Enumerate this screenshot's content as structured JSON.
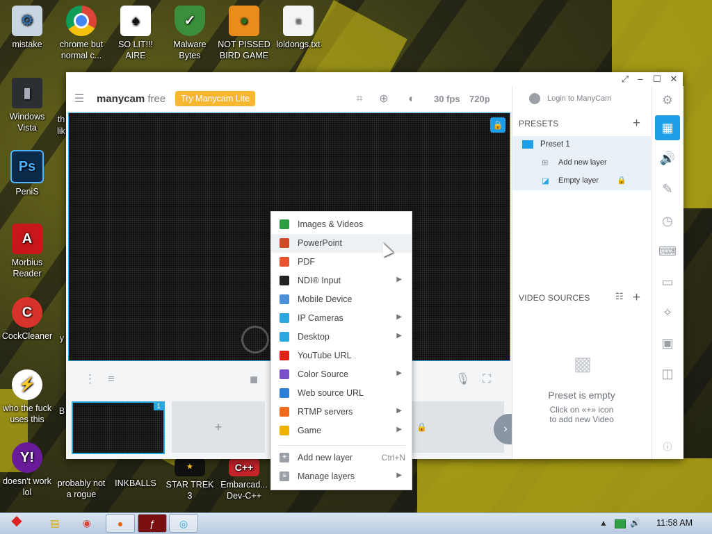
{
  "desktop": {
    "icons": [
      {
        "label": "mistake",
        "icon": "computer-setup-icon"
      },
      {
        "label": "chrome but normal c...",
        "icon": "chrome-icon"
      },
      {
        "label": "SO LIT!!! AIRE",
        "icon": "cards-icon"
      },
      {
        "label": "Malware Bytes",
        "icon": "shield-icon"
      },
      {
        "label": "NOT PISSED BIRD GAME",
        "icon": "pig-icon"
      },
      {
        "label": "loldongs.txt",
        "icon": "text-file-icon"
      },
      {
        "label": "Windows Vista",
        "icon": "recycle-bin-icon"
      },
      {
        "label": "PeniS",
        "icon": "photoshop-icon"
      },
      {
        "label": "Morbius Reader",
        "icon": "pdf-reader-icon"
      },
      {
        "label": "CockCleaner",
        "icon": "cleaner-icon"
      },
      {
        "label": "who the fuck uses this",
        "icon": "bolt-icon"
      },
      {
        "label": "doesn't work lol",
        "icon": "yahoo-icon"
      },
      {
        "label": "probably not a rogue",
        "icon": "shortcut-icon"
      },
      {
        "label": "INKBALLS",
        "icon": "game-icon"
      },
      {
        "label": "STAR TREK 3",
        "icon": "star-wars-icon"
      },
      {
        "label": "Embarcad... Dev-C++",
        "icon": "cpp-icon"
      }
    ],
    "partial_labels": [
      "th",
      "lik",
      "B",
      "y"
    ]
  },
  "window": {
    "logo_brand": "manycam",
    "logo_edition": "free",
    "try_button": "Try Manycam Lite",
    "fps": "30 fps",
    "resolution": "720p",
    "login": "Login to ManyCam"
  },
  "presets": {
    "title": "PRESETS",
    "preset_name": "Preset 1",
    "add_layer": "Add new layer",
    "empty_layer": "Empty layer"
  },
  "video_sources": {
    "title": "VIDEO SOURCES",
    "empty_title": "Preset is empty",
    "empty_sub_line1": "Click on «+» icon",
    "empty_sub_line2": "to add new Video"
  },
  "thumbs": {
    "active_badge": "1",
    "add_label": "+"
  },
  "context_menu": {
    "items": [
      {
        "label": "Images & Videos",
        "icon": "image-icon",
        "color": "#2e9e44",
        "submenu": false
      },
      {
        "label": "PowerPoint",
        "icon": "powerpoint-icon",
        "color": "#d24726",
        "submenu": false
      },
      {
        "label": "PDF",
        "icon": "pdf-icon",
        "color": "#e8542f",
        "submenu": false
      },
      {
        "label": "NDI® Input",
        "icon": "ndi-icon",
        "color": "#222222",
        "submenu": true
      },
      {
        "label": "Mobile Device",
        "icon": "mobile-icon",
        "color": "#4a90d9",
        "submenu": false
      },
      {
        "label": "IP Cameras",
        "icon": "ip-camera-icon",
        "color": "#2aa7e0",
        "submenu": true
      },
      {
        "label": "Desktop",
        "icon": "desktop-icon",
        "color": "#2aa7e0",
        "submenu": true
      },
      {
        "label": "YouTube URL",
        "icon": "youtube-icon",
        "color": "#e62117",
        "submenu": false
      },
      {
        "label": "Color Source",
        "icon": "paint-bucket-icon",
        "color": "#7b4fc9",
        "submenu": true
      },
      {
        "label": "Web source URL",
        "icon": "link-icon",
        "color": "#2a7fd9",
        "submenu": false
      },
      {
        "label": "RTMP servers",
        "icon": "rtmp-icon",
        "color": "#f26b1d",
        "submenu": true
      },
      {
        "label": "Game",
        "icon": "gamepad-icon",
        "color": "#f0b400",
        "submenu": true
      }
    ],
    "add_layer": "Add new layer",
    "add_layer_shortcut": "Ctrl+N",
    "manage_layers": "Manage layers"
  },
  "taskbar": {
    "clock": "11:58 AM"
  }
}
